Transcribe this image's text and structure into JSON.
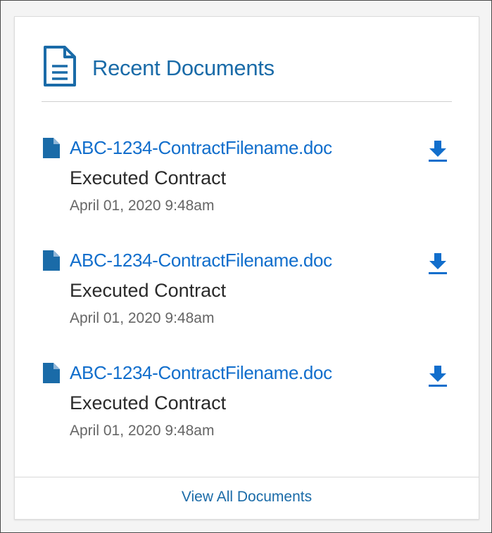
{
  "colors": {
    "accent": "#116ecc",
    "title": "#1a6ba8",
    "text_primary": "#2a2a2a",
    "text_secondary": "#666666",
    "card_background": "#ffffff",
    "page_background": "#f4f4f4"
  },
  "header": {
    "title": "Recent Documents",
    "icon": "document-lines-icon"
  },
  "documents": [
    {
      "icon": "file-icon",
      "filename": "ABC-1234-ContractFilename.doc",
      "type": "Executed Contract",
      "date": "April 01, 2020 9:48am",
      "action_icon": "download-icon"
    },
    {
      "icon": "file-icon",
      "filename": "ABC-1234-ContractFilename.doc",
      "type": "Executed Contract",
      "date": "April 01, 2020 9:48am",
      "action_icon": "download-icon"
    },
    {
      "icon": "file-icon",
      "filename": "ABC-1234-ContractFilename.doc",
      "type": "Executed Contract",
      "date": "April 01, 2020 9:48am",
      "action_icon": "download-icon"
    }
  ],
  "footer": {
    "view_all_label": "View All Documents"
  }
}
